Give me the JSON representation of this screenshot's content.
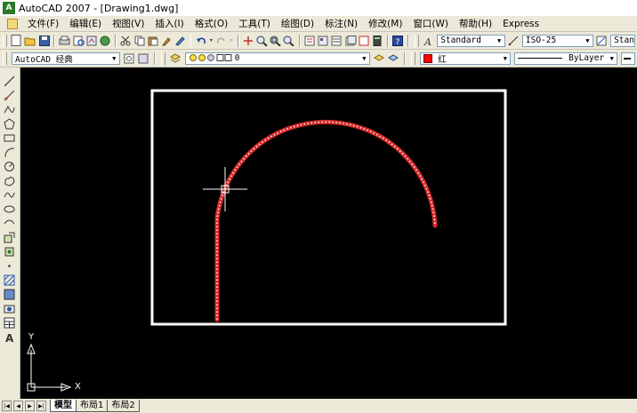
{
  "window": {
    "title": "AutoCAD 2007 - [Drawing1.dwg]",
    "logo": "A"
  },
  "menubar": {
    "items": [
      "文件(F)",
      "编辑(E)",
      "视图(V)",
      "插入(I)",
      "格式(O)",
      "工具(T)",
      "绘图(D)",
      "标注(N)",
      "修改(M)",
      "窗口(W)",
      "帮助(H)",
      "Express"
    ]
  },
  "toolbar_standard": {
    "text_style": "Standard",
    "dim_style": "ISO-25",
    "third_style": "Stan"
  },
  "toolbar_layers": {
    "workspace": "AutoCAD 经典",
    "layer": "0",
    "color": "红",
    "linetype": "ByLayer"
  },
  "colors": {
    "canvas": "#000000",
    "arc": "#d42a2a",
    "arc_selected": "#ffffff",
    "border": "#ffffff"
  },
  "ucs": {
    "x_label": "X",
    "y_label": "Y"
  },
  "layout_tabs": [
    "模型",
    "布局1",
    "布局2"
  ]
}
